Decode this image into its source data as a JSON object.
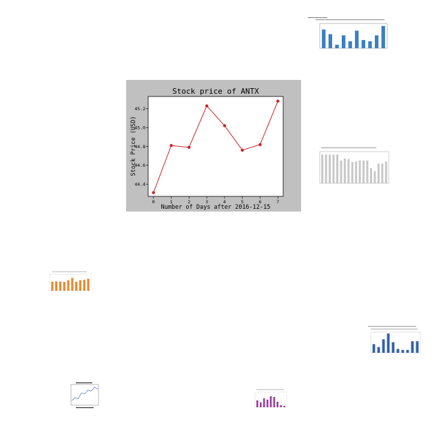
{
  "charts": {
    "main": {
      "chart_data": {
        "type": "line",
        "title": "Stock price of ANTX",
        "xlabel": "Number of Days after 2016-12-15",
        "ylabel": "Stock Price (USD)",
        "x": [
          0,
          1,
          2,
          3,
          4,
          5,
          6,
          7
        ],
        "values": [
          44.31,
          44.81,
          44.79,
          45.23,
          45.02,
          44.76,
          44.82,
          45.28
        ],
        "xticks": [
          "0",
          "1",
          "2",
          "3",
          "4",
          "5",
          "6",
          "7"
        ],
        "yticks": [
          "44.4",
          "44.6",
          "44.8",
          "45.0",
          "45.2"
        ],
        "xlim": [
          -0.3,
          7.3
        ],
        "ylim": [
          44.27,
          45.33
        ],
        "grid": false,
        "colors": {
          "line": "#cc2222",
          "background": "#c0c0c0",
          "plot": "#ffffff"
        }
      }
    },
    "thumbs": [
      {
        "name": "thumb-top-right-bar",
        "chart_data": {
          "type": "bar",
          "values": [
            0.8,
            0.6,
            0.15,
            0.55,
            0.3,
            0.75,
            0.35,
            0.3,
            0.55,
            0.95
          ],
          "color": "#3a7fc1"
        }
      },
      {
        "name": "thumb-mid-right-bar",
        "chart_data": {
          "type": "bar",
          "values": [
            0.95,
            0.95,
            0.95,
            0.95,
            0.95,
            0.75,
            0.82,
            0.8,
            0.7,
            0.72,
            0.75,
            0.75,
            0.75,
            0.5,
            0.4,
            0.65,
            0.65,
            0.72
          ],
          "color": "#c8c8c8"
        }
      },
      {
        "name": "thumb-left-orange-bar",
        "chart_data": {
          "type": "bar",
          "values": [
            0.6,
            0.62,
            0.6,
            0.58,
            0.7,
            0.85,
            0.6,
            0.7,
            0.72,
            0.8
          ],
          "color": "#e58a2b"
        }
      },
      {
        "name": "thumb-bottom-right-bar",
        "chart_data": {
          "type": "bar",
          "values": [
            0.45,
            0.3,
            0.7,
            1.0,
            0.55,
            0.2,
            0.15,
            0.15,
            0.6,
            0.6
          ],
          "color": "#3560a8"
        }
      },
      {
        "name": "thumb-bottom-left-line",
        "chart_data": {
          "type": "line",
          "values": [
            0.2,
            0.35,
            0.3,
            0.6,
            0.55,
            0.75,
            0.7,
            0.9,
            0.8
          ],
          "color": "#6a7fc8"
        }
      },
      {
        "name": "thumb-bottom-center-bar",
        "chart_data": {
          "type": "bar",
          "values": [
            0.5,
            0.35,
            0.65,
            0.55,
            0.8,
            0.75,
            0.4,
            0.15,
            0.1
          ],
          "color": "#9b3fa0"
        }
      }
    ]
  }
}
